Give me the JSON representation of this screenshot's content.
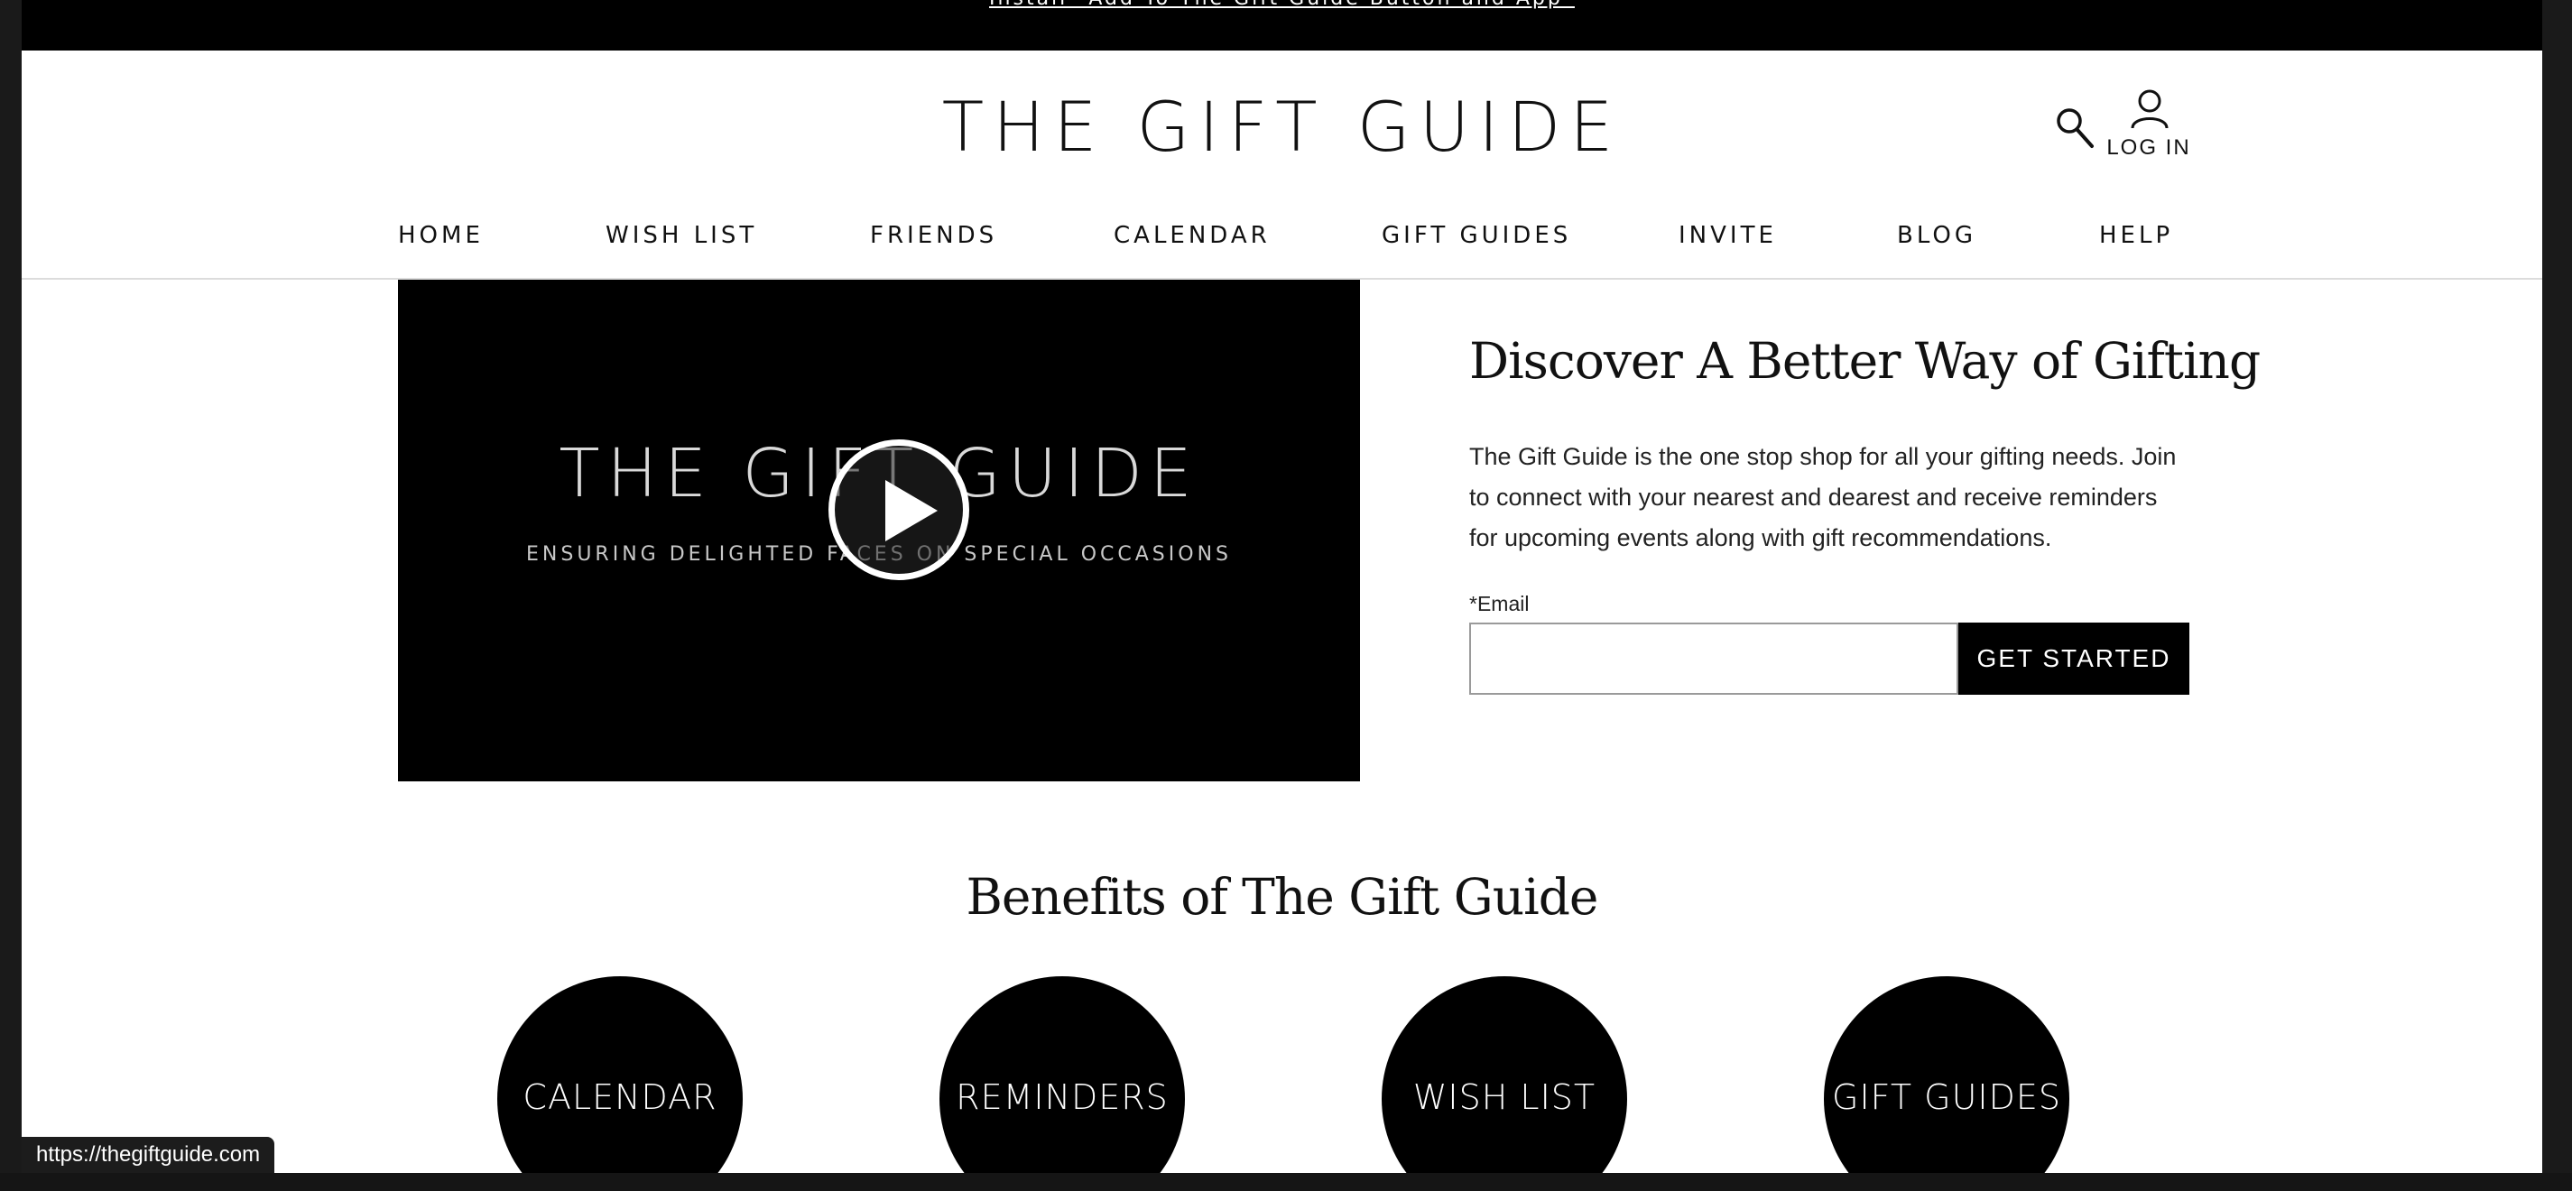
{
  "promo": {
    "link_text": "Install \"Add To The Gift Guide Button and App\""
  },
  "header": {
    "brand": "THE GIFT GUIDE",
    "login_label": "LOG IN"
  },
  "nav": {
    "items": [
      "HOME",
      "WISH LIST",
      "FRIENDS",
      "CALENDAR",
      "GIFT GUIDES",
      "INVITE",
      "BLOG",
      "HELP"
    ]
  },
  "video": {
    "title": "THE GIFT GUIDE",
    "subtitle": "ENSURING DELIGHTED FACES ON SPECIAL OCCASIONS"
  },
  "discover": {
    "title": "Discover A Better Way of Gifting",
    "body": "The Gift Guide is the one stop shop for all your gifting needs. Join to connect with your nearest and dearest and receive reminders for upcoming events along with gift recommendations.",
    "email_label": "*Email",
    "email_value": "",
    "email_placeholder": "",
    "button_label": "GET STARTED"
  },
  "benefits": {
    "title": "Benefits of The Gift Guide",
    "items": [
      "CALENDAR",
      "REMINDERS",
      "WISH LIST",
      "GIFT GUIDES"
    ]
  },
  "status_bar": {
    "url": "https://thegiftguide.com"
  },
  "colors": {
    "background": "#ffffff",
    "accent": "#000000",
    "text": "#111111"
  }
}
